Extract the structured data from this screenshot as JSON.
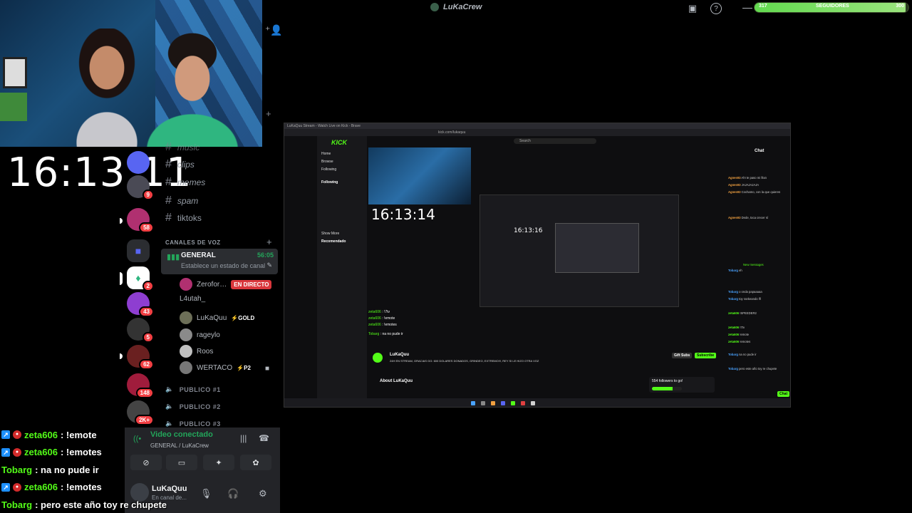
{
  "header": {
    "title": "LuKaCrew",
    "followers": {
      "current": "317",
      "label": "SEGUIDORES",
      "goal": "300",
      "fill_fraction": 0.98
    }
  },
  "clock": "16:13:11",
  "discord": {
    "servers": [
      {
        "badge": "9"
      },
      {
        "badge": "58"
      },
      {
        "badge": ""
      },
      {
        "badge": "2"
      },
      {
        "badge": "43"
      },
      {
        "badge": "5"
      },
      {
        "badge": "62"
      },
      {
        "badge": "148"
      },
      {
        "badge": "2K+"
      }
    ],
    "text_channels": [
      "music",
      "clips",
      "memes",
      "spam",
      "tiktoks"
    ],
    "voice_header": "CANALES DE VOZ",
    "voice_channel": {
      "name": "GENERAL",
      "time": "56:05",
      "status": "Establece un estado de canal"
    },
    "members": [
      {
        "name": "Zerofor…",
        "tag": "EN DIRECTO"
      },
      {
        "name": "L4utah_",
        "tag": ""
      },
      {
        "name": "LuKaQuu",
        "tag": "⚡GOLD"
      },
      {
        "name": "rageylo",
        "tag": ""
      },
      {
        "name": "Roos",
        "tag": ""
      },
      {
        "name": "WERTACO",
        "tag": "⚡P2"
      }
    ],
    "public_channels": [
      "PUBLICO #1",
      "PUBLICO #2",
      "PUBLICO #3"
    ],
    "voice_panel": {
      "status": "Video conectado",
      "sub": "GENERAL / LuKaCrew",
      "user": "LuKaQuu",
      "user_sub": "En canal de..."
    }
  },
  "stream_chat": [
    {
      "user": "zeta606",
      "msg": ": !emote",
      "color": "#53fc18",
      "badges": true
    },
    {
      "user": "zeta606",
      "msg": ": !emotes",
      "color": "#53fc18",
      "badges": true
    },
    {
      "user": "Tobarg",
      "msg": ": na no pude ir",
      "color": "#53fc18",
      "badges": false
    },
    {
      "user": "zeta606",
      "msg": ": !emotes",
      "color": "#53fc18",
      "badges": true
    },
    {
      "user": "Tobarg",
      "msg": ": pero este año toy re chupete",
      "color": "#53fc18",
      "badges": false
    }
  ],
  "shared_screen": {
    "window_title": "LuKaQuu Stream - Watch Live on Kick - Brave",
    "url": "kick.com/lukaquu",
    "search_placeholder": "Search",
    "logo": "KICK",
    "nav": [
      "Home",
      "Browse",
      "Following"
    ],
    "following_header": "Following",
    "recommended_header": "Recomendado",
    "show_more": "Show More",
    "nested_clock": "16:13:14",
    "nested_clock2": "16:13:16",
    "channel_name": "LuKaQuu",
    "stream_title": "24H EN STREAM, GRACIAS GG: 600 DOLARES DONADOS, GRINDEO, EXTREMO!!!, REY SI LE HIZO OTRA VOZ",
    "about": "About LuKaQuu",
    "subscribe": "Subscribe",
    "gift": "Gift Subs",
    "chat_title": "Chat",
    "goal_text": "554 followers to go!",
    "send_label": "Chat",
    "new_messages": "New messages",
    "chat_lines": [
      {
        "user": "Agnes93",
        "msg": "Ah! te paso mi fitxn"
      },
      {
        "user": "Agnes93",
        "msg": "JAJAJAJAJA"
      },
      {
        "user": "Agnes93",
        "msg": "Cochamo, con la que quieres"
      },
      {
        "user": "Agnes93",
        "msg": "Dede, toca crecer sí"
      },
      {
        "user": "Tobarg",
        "msg": "eh"
      },
      {
        "user": "Tobarg",
        "msg": "o onda papaaaaa"
      },
      {
        "user": "Tobarg",
        "msg": "toy rankeando lfl"
      },
      {
        "user": "zeta606",
        "msg": "!SPEEDER2"
      },
      {
        "user": "zeta606",
        "msg": "!7tv"
      },
      {
        "user": "zeta606",
        "msg": "!emote"
      },
      {
        "user": "zeta606",
        "msg": "!emotes"
      },
      {
        "user": "Tobarg",
        "msg": "na no pude ir"
      },
      {
        "user": "Tobarg",
        "msg": "pero este año toy re chupete"
      }
    ],
    "mini_chat": [
      {
        "user": "zeta606",
        "msg": ": !7tv"
      },
      {
        "user": "zeta606",
        "msg": ": !emote"
      },
      {
        "user": "zeta606",
        "msg": ": !emotes"
      },
      {
        "user": "Tobarg",
        "msg": ": na no pude ir"
      }
    ]
  },
  "colors": {
    "kick_green": "#53fc18",
    "discord_green": "#23a55a",
    "live_red": "#da373c"
  }
}
